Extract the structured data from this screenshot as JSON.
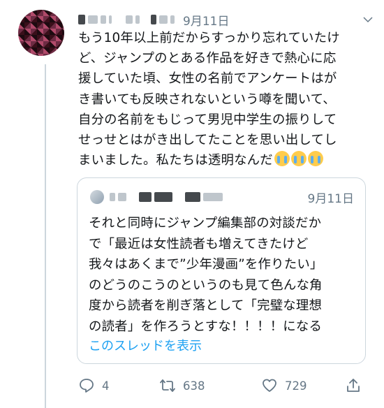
{
  "tweet": {
    "date": "9月11日",
    "text": "もう10年以上前だからすっかり忘れていたけ\nど、ジャンプのとある作品を好きで熱心に応\n援していた頃、女性の名前でアンケートはが\nき書いても反映されないという噂を聞いて、\n自分の名前をもじって男児中学生の振りして\nせっせとはがき出してたことを思い出してし\nまいました。私たちは透明なんだ",
    "emoji": "loudly-crying-face ×3"
  },
  "quote": {
    "date": "9月11日",
    "text": "それと同時にジャンプ編集部の対談だか\nで「最近は女性読者も増えてきたけど\n我々はあくまで”少年漫画”を作りたい」\nのどうのこうのというのも見て色んな角\n度から読者を削ぎ落として「完璧な理想\nの読者」を作ろうとすな！！！！になる",
    "show_thread": "このスレッドを表示"
  },
  "actions": {
    "reply_count": "4",
    "retweet_count": "638",
    "like_count": "729"
  },
  "colors": {
    "text": "#14171a",
    "secondary": "#657786",
    "link": "#1da1f2",
    "border": "#ccd6dd"
  }
}
